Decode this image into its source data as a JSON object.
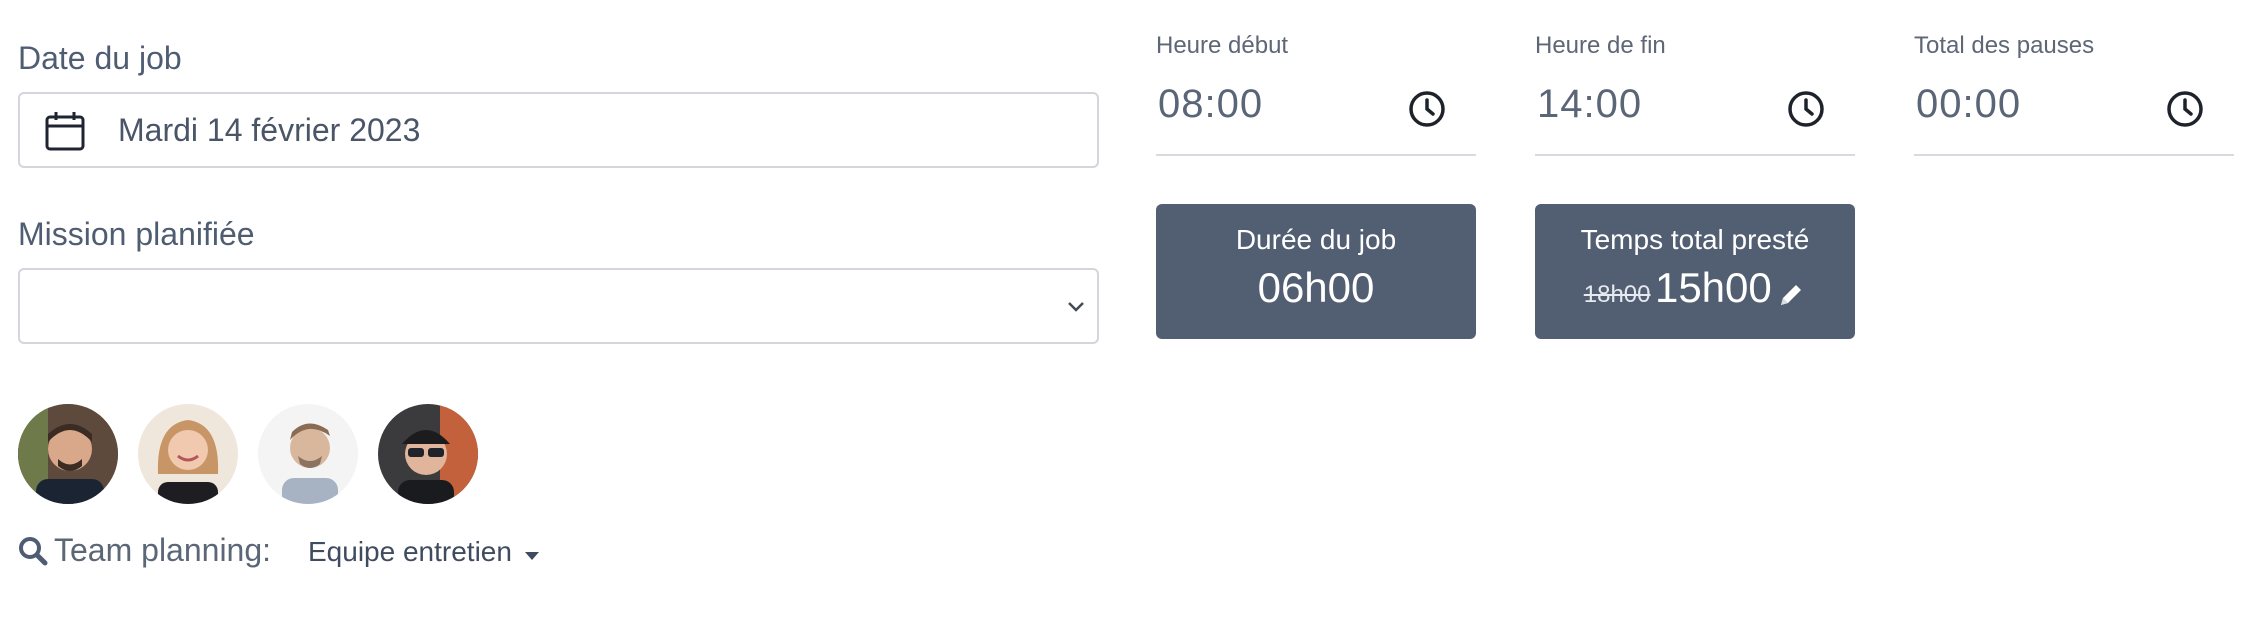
{
  "date": {
    "label": "Date du job",
    "value": "Mardi 14 février 2023",
    "icon": "calendar-icon"
  },
  "mission": {
    "label": "Mission planifiée",
    "value": "",
    "icon": "chevron-down-icon"
  },
  "times": {
    "start": {
      "label": "Heure début",
      "value": "08:00",
      "icon": "clock-icon"
    },
    "end": {
      "label": "Heure de fin",
      "value": "14:00",
      "icon": "clock-icon"
    },
    "breaks": {
      "label": "Total des pauses",
      "value": "00:00",
      "icon": "clock-icon"
    }
  },
  "cards": {
    "duration": {
      "title": "Durée du job",
      "value": "06h00"
    },
    "total": {
      "title": "Temps total presté",
      "old_value": "18h00",
      "value": "15h00",
      "icon": "pencil-icon"
    }
  },
  "team": {
    "avatars": [
      "avatar-1",
      "avatar-2",
      "avatar-3",
      "avatar-4"
    ],
    "label": "Team planning:",
    "selected": "Equipe entretien",
    "icon": "search-icon"
  },
  "colors": {
    "card_bg": "#525f73",
    "text": "#4f5d72",
    "border": "#d3d6da"
  }
}
